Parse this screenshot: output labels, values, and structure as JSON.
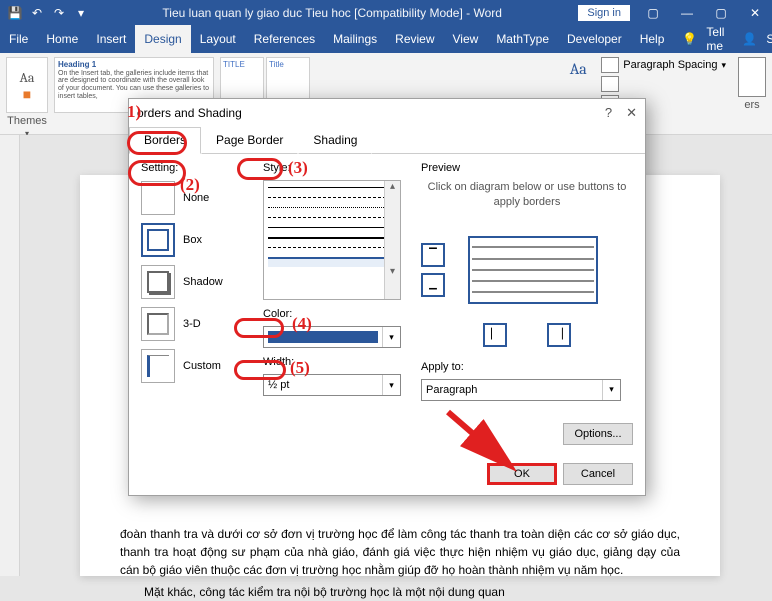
{
  "titlebar": {
    "doc_title": "Tieu luan quan ly giao duc Tieu hoc [Compatibility Mode]  -  Word",
    "signin": "Sign in"
  },
  "tabs": {
    "file": "File",
    "home": "Home",
    "insert": "Insert",
    "design": "Design",
    "layout": "Layout",
    "references": "References",
    "mailings": "Mailings",
    "review": "Review",
    "view": "View",
    "mathtype": "MathType",
    "developer": "Developer",
    "help": "Help",
    "tellme": "Tell me",
    "share": "Share"
  },
  "ribbon": {
    "themes_label": "Themes",
    "aa": "Aa",
    "gallery_heading": "Heading 1",
    "gallery_text": "On the Insert tab, the galleries include items that are designed to coordinate with the overall look of your document. You can use these galleries to insert tables,",
    "style_title_1": "TITLE",
    "style_title_2": "Title",
    "paragraph_spacing": "Paragraph Spacing",
    "borders_label": "ers"
  },
  "dialog": {
    "title": "orders and Shading",
    "tabs": {
      "borders": "Borders",
      "page_border": "Page Border",
      "shading": "Shading"
    },
    "setting_label": "Setting:",
    "settings": {
      "none": "None",
      "box": "Box",
      "shadow": "Shadow",
      "threed": "3-D",
      "custom": "Custom"
    },
    "style_label": "Style:",
    "color_label": "Color:",
    "width_label": "Width:",
    "width_value": "½ pt",
    "preview_label": "Preview",
    "preview_hint": "Click on diagram below or use buttons to apply borders",
    "applyto_label": "Apply to:",
    "applyto_value": "Paragraph",
    "options": "Options...",
    "ok": "OK",
    "cancel": "Cancel"
  },
  "doc_text": "đoàn thanh tra và dưới cơ sở đơn vị trường học để làm công tác thanh tra toàn diện các cơ sở giáo dục, thanh tra hoạt động sư phạm của nhà giáo, đánh giá việc thực hiện nhiệm vụ giáo dục, giảng dạy của cán bộ giáo viên thuộc các đơn vị trường học nhằm giúp đỡ họ hoàn thành nhiệm vụ năm học.",
  "doc_text2": "Mặt khác, công tác kiểm tra nội bộ trường học là một nội dung quan",
  "annotations": {
    "n1": "1)",
    "n2": "(2)",
    "n3": "(3)",
    "n4": "(4)",
    "n5": "(5)"
  }
}
